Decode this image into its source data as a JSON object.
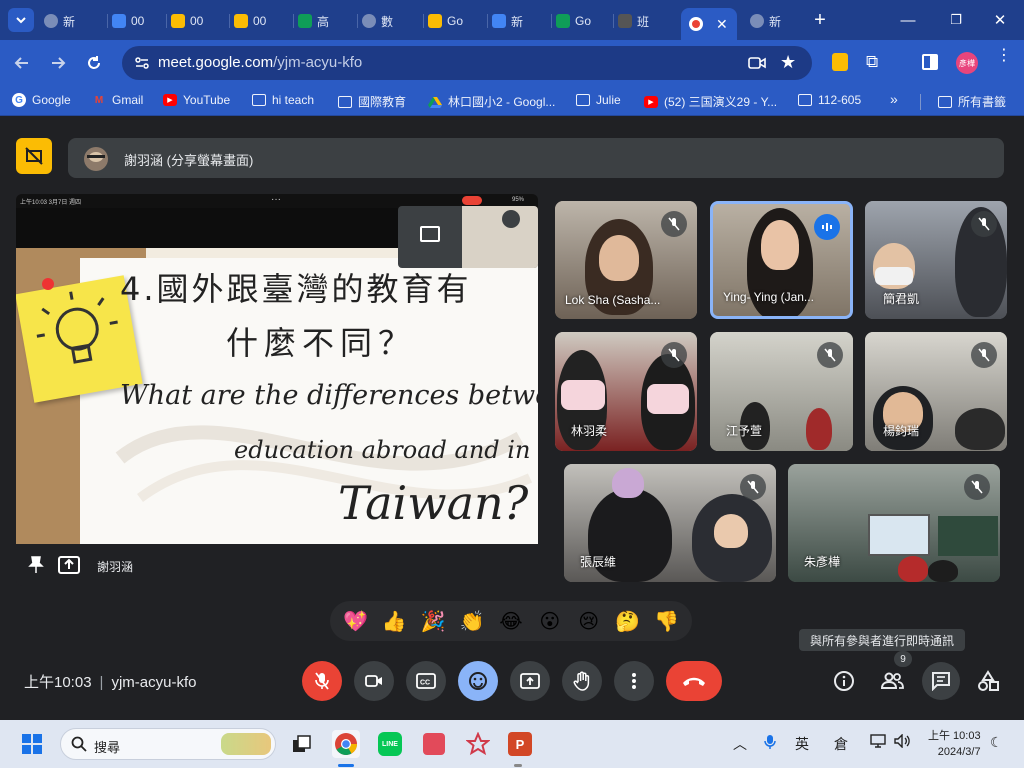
{
  "browser": {
    "tabs": [
      {
        "label": "新",
        "icon": "globe-icon",
        "color": "#7a8db8"
      },
      {
        "label": "00",
        "icon": "docs-icon",
        "color": "#4285f4"
      },
      {
        "label": "00",
        "icon": "slides-icon",
        "color": "#fbbc04"
      },
      {
        "label": "00",
        "icon": "slides-icon",
        "color": "#fbbc04"
      },
      {
        "label": "高",
        "icon": "sheets-icon",
        "color": "#0f9d58"
      },
      {
        "label": "數",
        "icon": "globe-icon",
        "color": "#7a8db8"
      },
      {
        "label": "Go",
        "icon": "keep-icon",
        "color": "#fbbc04"
      },
      {
        "label": "新",
        "icon": "forms-icon",
        "color": "#4285f4"
      },
      {
        "label": "Go",
        "icon": "classroom-icon",
        "color": "#0f9d58"
      },
      {
        "label": "班",
        "icon": "photo-icon",
        "color": "#555555"
      }
    ],
    "active_tab_icon": "meet-record-icon",
    "last_tab": {
      "label": "新",
      "icon": "globe-icon"
    },
    "url_host": "meet.google.com",
    "url_path": "/yjm-acyu-kfo",
    "profile_label": "彥樺",
    "bookmarks": [
      {
        "label": "Google",
        "icon": "google-icon"
      },
      {
        "label": "Gmail",
        "icon": "gmail-icon"
      },
      {
        "label": "YouTube",
        "icon": "youtube-icon"
      },
      {
        "label": "hi teach",
        "icon": "folder-icon"
      },
      {
        "label": "國際教育",
        "icon": "folder-icon"
      },
      {
        "label": "林口國小2 - Googl...",
        "icon": "drive-icon"
      },
      {
        "label": "Julie",
        "icon": "folder-icon"
      },
      {
        "label": "(52) 三国演义29 - Y...",
        "icon": "youtube-icon"
      },
      {
        "label": "112-605",
        "icon": "folder-icon"
      }
    ],
    "bookmarks_more": "»",
    "all_bookmarks": "所有書籤"
  },
  "meet": {
    "presenter_label": "謝羽涵 (分享螢幕畫面)",
    "share_owner": "謝羽涵",
    "ipad_status_left": "上午10:03  3月7日 週四",
    "ipad_status_right": "95%",
    "slide": {
      "line1": "4.國外跟臺灣的教育有",
      "line2": "什麼不同？",
      "line3": "What are the differences between",
      "line4": "education abroad and in",
      "line5": "Taiwan?"
    },
    "participants": [
      {
        "name": "Lok Sha (Sasha...",
        "speaking": false
      },
      {
        "name": "Ying- Ying (Jan...",
        "speaking": true
      },
      {
        "name": "簡君凱",
        "speaking": false
      },
      {
        "name": "林羽柔",
        "speaking": false
      },
      {
        "name": "江予萱",
        "speaking": false
      },
      {
        "name": "楊鈞瑞",
        "speaking": false
      },
      {
        "name": "張辰維",
        "speaking": false
      },
      {
        "name": "朱彥樺",
        "speaking": false
      }
    ],
    "reactions": [
      "💖",
      "👍",
      "🎉",
      "👏",
      "😂",
      "😮",
      "😢",
      "🤔",
      "👎"
    ],
    "tooltip": "與所有參與者進行即時通訊",
    "time": "上午10:03",
    "meeting_code": "yjm-acyu-kfo",
    "participant_count": "9",
    "accent": "#8ab4f8",
    "hangup_color": "#ea4335"
  },
  "taskbar": {
    "search_placeholder": "搜尋",
    "ime1": "英",
    "ime2": "倉",
    "time": "上午 10:03",
    "date": "2024/3/7"
  }
}
